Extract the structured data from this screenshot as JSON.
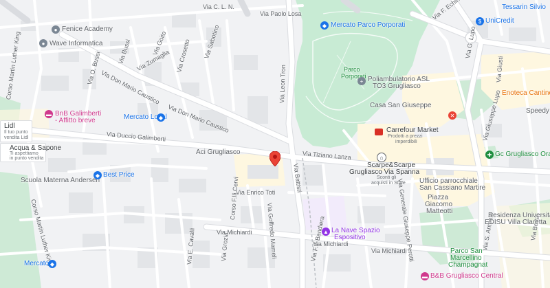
{
  "streets": {
    "via_colombo": "Via C. L. N.",
    "via_paolo_losa": "Via Paolo Losa",
    "via_echinelle": "Via F. Echinelle",
    "via_sabotino": "Via Sabotino",
    "via_crosetto": "Via Crosetto",
    "via_goito": "Via Goito",
    "via_bussi": "Via Bussi",
    "via_zumaglia": "Via Zumaglia",
    "via_duca": "Via O. Bussi",
    "via_don_caustico_1": "Via Don Mario Caustico",
    "via_don_caustico_2": "Via Don Mario Caustico",
    "corso_luther_king_1": "Corso Martin Luther King",
    "corso_luther_king_2": "Corso Martin Luther King",
    "via_duccio": "Via Duccio Galimberti",
    "via_leon_tron": "Via Leon Tron",
    "via_tiziano_lanza": "Via Tiziano Lanza",
    "via_battisti": "Via Battisti",
    "via_enrico_toti": "Via Enrico Toti",
    "corso_fili_cervi": "Corso F.lli Cervi",
    "via_goffredo_mameli": "Via Goffredo Mameli",
    "via_grozia": "Via Grozia",
    "via_cavalli": "Via E. Cavalli",
    "via_michiardi_1": "Via Michiardi",
    "via_michiardi_2": "Via Michiardi",
    "via_michiardi_3": "Via Michiardi",
    "via_pettiti": "Via Generale Giuseppe Perotti",
    "via_lupo": "Via G. Lupo",
    "via_giusti": "Via Giusti",
    "via_lupo_2": "Via Giuseppe Lupo",
    "via_berta": "Via Berta",
    "via_san_vacchi": "Via S. Antonio",
    "via_f_nerni": "Via F.lli Bandiera"
  },
  "pois": {
    "fenice": "Fenice Academy",
    "wave": "Wave Informatica",
    "mercato_parco": "Mercato Parco Porporati",
    "parco_porporati": "Parco\nPorporati",
    "poliambulatorio_1": "Poliambulatorio ASL",
    "poliambulatorio_2": "TO3 Grugliasco",
    "casa_san_giuseppe": "Casa San Giuseppe",
    "bnb_galimberti_1": "BnB Galimberti",
    "bnb_galimberti_2": "- Affitto breve",
    "mercato_local": "Mercato Local",
    "lidl": "Lidl",
    "lidl_sub1": "Il tuo punto",
    "lidl_sub2": "vendita Lidl",
    "acqua_sapone": "Acqua & Sapone",
    "acqua_sub1": "Ti aspettiamo",
    "acqua_sub2": "in punto vendita",
    "aci": "Aci Grugliasco",
    "carrefour": "Carrefour Market",
    "carrefour_sub1": "Prodotti a prezzi",
    "carrefour_sub2": "imperdibili",
    "scarpe_1": "Scarpe&Scarpe",
    "scarpe_2": "Grugliasco Via Spanna",
    "scarpe_sub1": "Sconti gli",
    "scarpe_sub2": "acquisti in Store",
    "scuola": "Scuola Materna Andersen",
    "best_price": "Best Price",
    "la_nave_1": "La Nave Spazio",
    "la_nave_2": "Espositivo",
    "ufficio_1": "Ufficio parrocchiale",
    "ufficio_2": "San Cassiano Martire",
    "piazza_1": "Piazza",
    "piazza_2": "Giacomo",
    "piazza_3": "Matteotti",
    "residenza_1": "Residenza Universitaria",
    "residenza_2": "EDISU Villa Claretta",
    "parco_marcellino_1": "Parco San",
    "parco_marcellino_2": "Marcellino",
    "parco_marcellino_3": "Champagnat",
    "bnb_central": "B&B Grugliasco Central",
    "mercato_bottom": "Mercato",
    "gc_oratorio": "Gc Grugliasco Oratorio",
    "enoteca": "Enoteca Cantine Vespa",
    "speedy": "Speedy Bu",
    "unicredit": "UniCredit",
    "tessarin": "Tessarin Silvio"
  },
  "colors": {
    "park": "#c8ebd4",
    "park_dark": "#b7e4c7",
    "road_major": "#ffffff",
    "road_border": "#dadce0",
    "building": "#e8eaed",
    "highlight_yellow": "#fef7e0",
    "marker_red": "#ea4335"
  },
  "icons": {
    "selected_marker": "location-pin-icon",
    "shopping": "shopping-bag-icon",
    "cart": "cart-icon",
    "bed": "bed-icon",
    "bank": "bank-icon",
    "wine": "wine-icon"
  }
}
